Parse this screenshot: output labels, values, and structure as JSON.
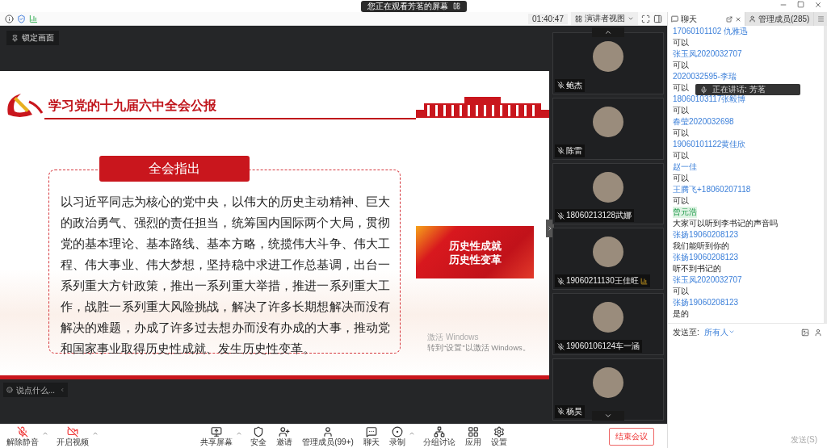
{
  "top_bar": {
    "screen_notice": "您正在观看芳茗的屏幕"
  },
  "view_bar": {
    "timer": "01:40:47",
    "view_mode": "演讲者视图"
  },
  "stage": {
    "lock_button": "锁定画面",
    "comment_placeholder": "说点什么...",
    "slide": {
      "title": "学习党的十九届六中全会公报",
      "box_heading": "全会指出",
      "paragraph": "以习近平同志为核心的党中央，以伟大的历史主动精神、巨大的政治勇气、强烈的责任担当，统筹国内国际两个大局，贯彻党的基本理论、基本路线、基本方略，统揽伟大斗争、伟大工程、伟大事业、伟大梦想，坚持稳中求进工作总基调，出台一系列重大方针政策，推出一系列重大举措，推进一系列重大工作，战胜一系列重大风险挑战，解决了许多长期想解决而没有解决的难题，办成了许多过去想办而没有办成的大事，推动党和国家事业取得历史性成就、发生历史性变革。",
      "banner_lines": [
        "历史性成就",
        "历史性变革"
      ],
      "system_notice": [
        "激活 Windows",
        "转到“设置”以激活 Windows。"
      ]
    }
  },
  "participants": [
    {
      "name": "鲍杰",
      "audio_bars": false
    },
    {
      "name": "陈雷",
      "audio_bars": false
    },
    {
      "name": "18060213128武娜",
      "audio_bars": false
    },
    {
      "name": "19060211130王佳旺",
      "audio_bars": true
    },
    {
      "name": "19060106124车一涵",
      "audio_bars": false
    },
    {
      "name": "杨昊",
      "audio_bars": false
    }
  ],
  "toolbar": {
    "left": [
      {
        "label": "解除静音",
        "off": true,
        "menu": true
      },
      {
        "label": "开启视频",
        "off": true,
        "menu": true
      }
    ],
    "center": [
      {
        "label": "共享屏幕",
        "menu": true
      },
      {
        "label": "安全",
        "menu": false
      },
      {
        "label": "邀请",
        "menu": false
      },
      {
        "label": "管理成员(99+)",
        "menu": false
      },
      {
        "label": "聊天",
        "menu": false
      },
      {
        "label": "录制",
        "menu": true
      },
      {
        "label": "分组讨论",
        "menu": false
      },
      {
        "label": "应用",
        "menu": false
      },
      {
        "label": "设置",
        "menu": false
      }
    ],
    "end_button": "结束会议"
  },
  "chat": {
    "tabs": [
      {
        "label": "聊天",
        "selected": true
      },
      {
        "label": "管理成员(285)",
        "selected": false
      }
    ],
    "messages": [
      {
        "sender": "17060101102 仇雅迅",
        "highlighted": false,
        "text": "可以"
      },
      {
        "sender": "张玉凤2020032707",
        "highlighted": false,
        "text": "可以"
      },
      {
        "sender": "2020032595-李瑞",
        "highlighted": false,
        "text": "可以"
      },
      {
        "sender": "18060103117张毅博",
        "highlighted": false,
        "text": "可以"
      },
      {
        "sender": "春莹2020032698",
        "highlighted": false,
        "text": "可以"
      },
      {
        "sender": "19060101122黄佳欣",
        "highlighted": false,
        "text": "可以"
      },
      {
        "sender": "赵一佳",
        "highlighted": false,
        "text": "可以"
      },
      {
        "sender": "王腾飞+18060207118",
        "highlighted": false,
        "text": "可以"
      },
      {
        "sender": "曾元浩",
        "highlighted": true,
        "text": "大家可以听到李书记的声音吗"
      },
      {
        "sender": "张扬19060208123",
        "highlighted": false,
        "text": "我们能听到你的"
      },
      {
        "sender": "张扬19060208123",
        "highlighted": false,
        "text": "听不到书记的"
      },
      {
        "sender": "张玉凤2020032707",
        "highlighted": false,
        "text": "可以"
      },
      {
        "sender": "张扬19060208123",
        "highlighted": false,
        "text": "是的"
      }
    ],
    "speaking_notice": "正在讲话: 芳茗",
    "send_to_label": "发送至:",
    "send_to_value": "所有人",
    "send_button": "发送(S)"
  }
}
